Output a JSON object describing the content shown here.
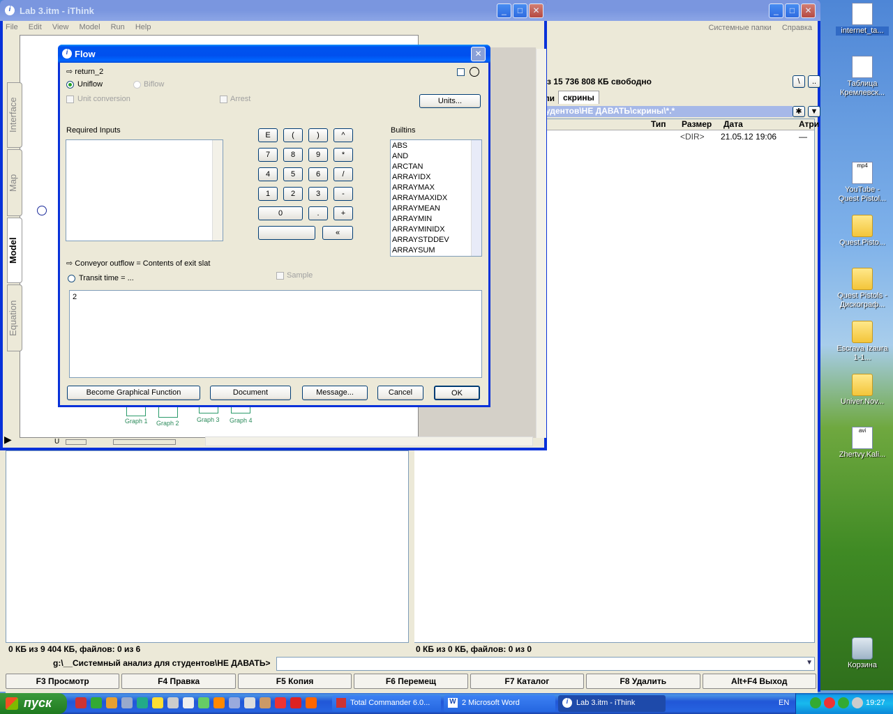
{
  "desktop": {
    "icons": [
      {
        "label": "internet_ta...",
        "kind": "doc"
      },
      {
        "label": "Таблица Кремлевск...",
        "kind": "doc"
      },
      {
        "label": "YouTube - Quest Pistol...",
        "kind": "video"
      },
      {
        "label": "Quest.Pisto...",
        "kind": "folder"
      },
      {
        "label": "Quest Pistols - Дискограф...",
        "kind": "folder"
      },
      {
        "label": "Escrava Izaura 1-1...",
        "kind": "folder"
      },
      {
        "label": "Univer.Nov...",
        "kind": "folder"
      },
      {
        "label": "Zhertvy.Kali...",
        "kind": "video"
      },
      {
        "label": "Корзина",
        "kind": "recycle"
      }
    ],
    "video_tags": {
      "mp4": "mp4",
      "avi": "avi"
    }
  },
  "tc": {
    "menu_extra": [
      "Системные папки",
      "Справка"
    ],
    "free_space": "з 15 736 808 КБ свободно",
    "tab_partial": "ли",
    "tab_active": "скрины",
    "path": "удентов\\НЕ ДАВАТЬ\\скрины\\*.*",
    "columns": [
      "Тип",
      "Размер",
      "Дата",
      "Атри"
    ],
    "row": {
      "size": "<DIR>",
      "date": "21.05.12 19:06",
      "attr": "—"
    },
    "status_left": "0 КБ из 9 404 КБ, файлов: 0 из 6",
    "status_right": "0 КБ из 0 КБ, файлов: 0 из 0",
    "cmd_path": "g:\\__Системный анализ для студентов\\НЕ ДАВАТЬ>",
    "fkeys": [
      "F3 Просмотр",
      "F4 Правка",
      "F5 Копия",
      "F6 Перемещ",
      "F7 Каталог",
      "F8 Удалить",
      "Alt+F4 Выход"
    ]
  },
  "ithink": {
    "title": "Lab 3.itm - iThink",
    "menu": [
      "File",
      "Edit",
      "View",
      "Model",
      "Run",
      "Help"
    ],
    "tabs": [
      "Interface",
      "Map",
      "Model",
      "Equation"
    ],
    "graphs": [
      "Graph 1",
      "Graph 2",
      "Graph 3",
      "Graph 4"
    ],
    "run_controls": [
      "U"
    ]
  },
  "flow": {
    "title": "Flow",
    "name": "return_2",
    "uniflow": "Uniflow",
    "biflow": "Biflow",
    "unit_conversion": "Unit conversion",
    "arrest": "Arrest",
    "units_button": "Units...",
    "required_inputs": "Required Inputs",
    "builtins_label": "Builtins",
    "keypad": [
      "E",
      "(",
      ")",
      "^",
      "7",
      "8",
      "9",
      "*",
      "4",
      "5",
      "6",
      "/",
      "1",
      "2",
      "3",
      "-",
      "0",
      ".",
      "+",
      "«"
    ],
    "builtins": [
      "ABS",
      "AND",
      "ARCTAN",
      "ARRAYIDX",
      "ARRAYMAX",
      "ARRAYMAXIDX",
      "ARRAYMEAN",
      "ARRAYMIN",
      "ARRAYMINIDX",
      "ARRAYSTDDEV",
      "ARRAYSUM"
    ],
    "conveyor_text": "Conveyor outflow = Contents of exit slat",
    "transit_time": "Transit time = ...",
    "sample": "Sample",
    "equation_value": "2",
    "buttons": {
      "become_graphical": "Become Graphical Function",
      "document": "Document",
      "message": "Message...",
      "cancel": "Cancel",
      "ok": "OK"
    }
  },
  "taskbar": {
    "start": "пуск",
    "tasks": [
      "Total Commander 6.0...",
      "2 Microsoft Word",
      "Lab 3.itm - iThink"
    ],
    "lang": "EN",
    "clock": "19:27"
  }
}
